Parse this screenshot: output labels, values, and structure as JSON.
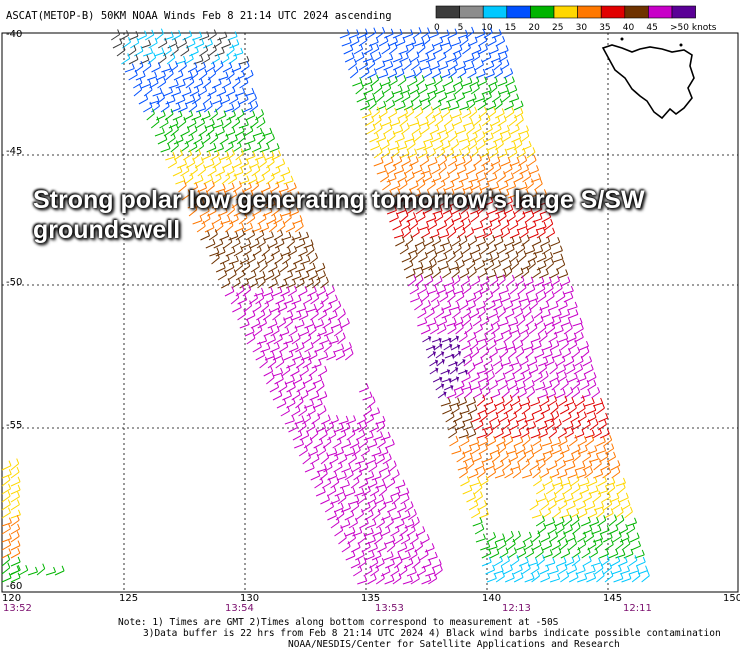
{
  "header": {
    "title": "ASCAT(METOP-B) 50KM NOAA Winds Feb  8 21:14 UTC 2024 ascending"
  },
  "legend": {
    "ticks": [
      "0",
      "5",
      "10",
      "15",
      "20",
      "25",
      "30",
      "35",
      "40",
      "45",
      ">50 knots"
    ],
    "colors": [
      "#3c3c3c",
      "#8c8c8c",
      "#00c8ff",
      "#0050ff",
      "#00b400",
      "#ffd700",
      "#ff7800",
      "#e10000",
      "#6e3200",
      "#c800c8",
      "#5a0096"
    ]
  },
  "overlay": {
    "line1": "Strong polar low generating tomorrow's large S/SW",
    "line2": "groundswell"
  },
  "map": {
    "lat_labels": [
      "-40",
      "-45",
      "-50",
      "-55",
      "-60"
    ],
    "lon_labels": [
      "120",
      "125",
      "130",
      "135",
      "140",
      "145",
      "150"
    ],
    "times": [
      "13:52",
      "13:54",
      "13:53",
      "12:13",
      "12:11"
    ]
  },
  "notes": {
    "line1": "Note: 1) Times are GMT 2)Times along bottom correspond to measurement at -50S",
    "line2": "3)Data buffer is 22 hrs from Feb  8 21:14 UTC 2024 4) Black wind barbs indicate possible contamination",
    "line3": "NOAA/NESDIS/Center for Satellite Applications and Research"
  }
}
